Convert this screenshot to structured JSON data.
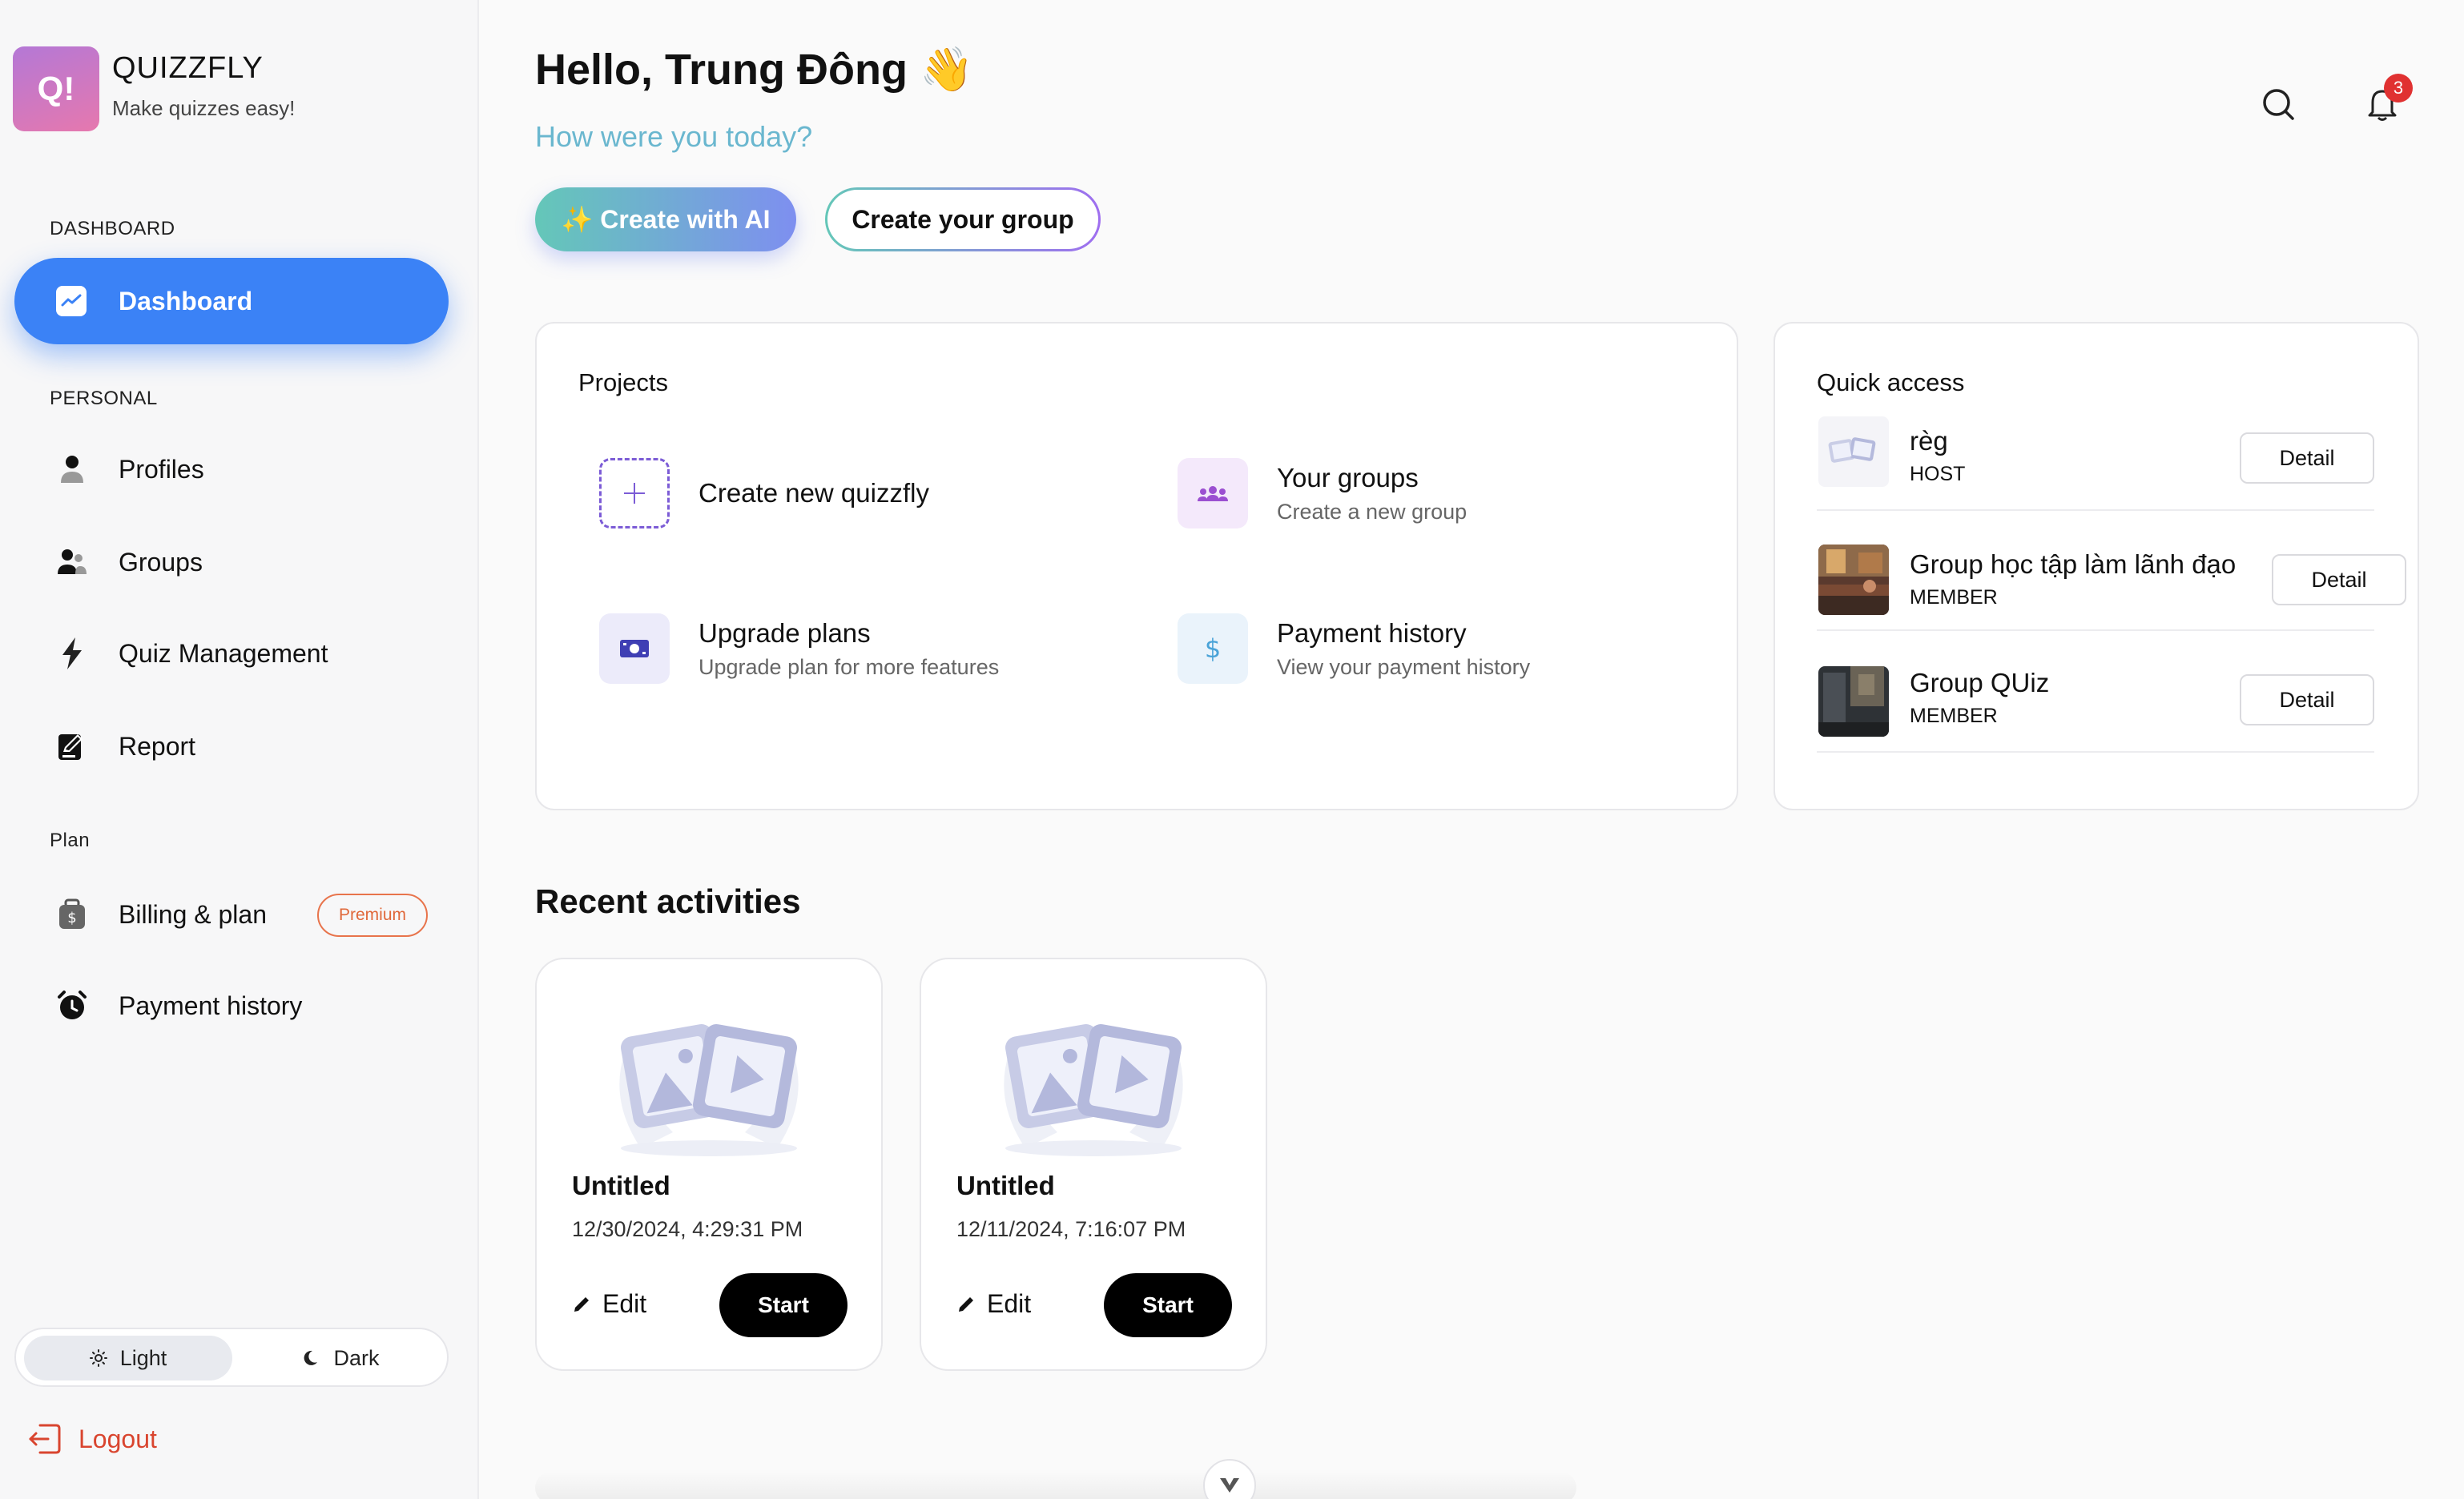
{
  "brand": {
    "logo_text": "Q!",
    "name": "QUIZZFLY",
    "tagline": "Make quizzes easy!"
  },
  "sidebar": {
    "sections": {
      "dashboard": "DASHBOARD",
      "personal": "PERSONAL",
      "plan": "Plan"
    },
    "items": [
      {
        "label": "Dashboard",
        "icon": "chart-icon",
        "active": true
      },
      {
        "label": "Profiles",
        "icon": "user-icon"
      },
      {
        "label": "Groups",
        "icon": "users-icon"
      },
      {
        "label": "Quiz Management",
        "icon": "bolt-icon"
      },
      {
        "label": "Report",
        "icon": "report-icon"
      },
      {
        "label": "Billing & plan",
        "icon": "wallet-icon",
        "badge": "Premium"
      },
      {
        "label": "Payment history",
        "icon": "alarm-icon"
      }
    ],
    "theme": {
      "light": "Light",
      "dark": "Dark",
      "selected": "Light"
    },
    "logout": "Logout"
  },
  "header": {
    "greeting": "Hello, Trung Đông 👋",
    "subtitle": "How were you today?",
    "create_ai": "✨ Create with AI",
    "create_group": "Create your group",
    "notification_count": "3"
  },
  "projects": {
    "title": "Projects",
    "items": [
      {
        "title": "Create new quizzfly",
        "subtitle": "",
        "icon": "plus-icon"
      },
      {
        "title": "Your groups",
        "subtitle": "Create a new group",
        "icon": "group-icon"
      },
      {
        "title": "Upgrade plans",
        "subtitle": "Upgrade plan for more features",
        "icon": "money-icon"
      },
      {
        "title": "Payment history",
        "subtitle": "View your payment history",
        "icon": "dollar-icon"
      }
    ]
  },
  "quick_access": {
    "title": "Quick access",
    "detail_label": "Detail",
    "items": [
      {
        "name": "règ",
        "role": "HOST"
      },
      {
        "name": "Group học tập làm lãnh đạo",
        "role": "MEMBER"
      },
      {
        "name": "Group QUiz",
        "role": "MEMBER"
      }
    ]
  },
  "recent": {
    "title": "Recent activities",
    "edit_label": "Edit",
    "start_label": "Start",
    "items": [
      {
        "title": "Untitled",
        "date": "12/30/2024, 4:29:31 PM"
      },
      {
        "title": "Untitled",
        "date": "12/11/2024, 7:16:07 PM"
      }
    ]
  },
  "colors": {
    "accent": "#3b82f6",
    "danger": "#d9452f",
    "premium": "#e0683a",
    "subtitle": "#6ab7cf"
  }
}
